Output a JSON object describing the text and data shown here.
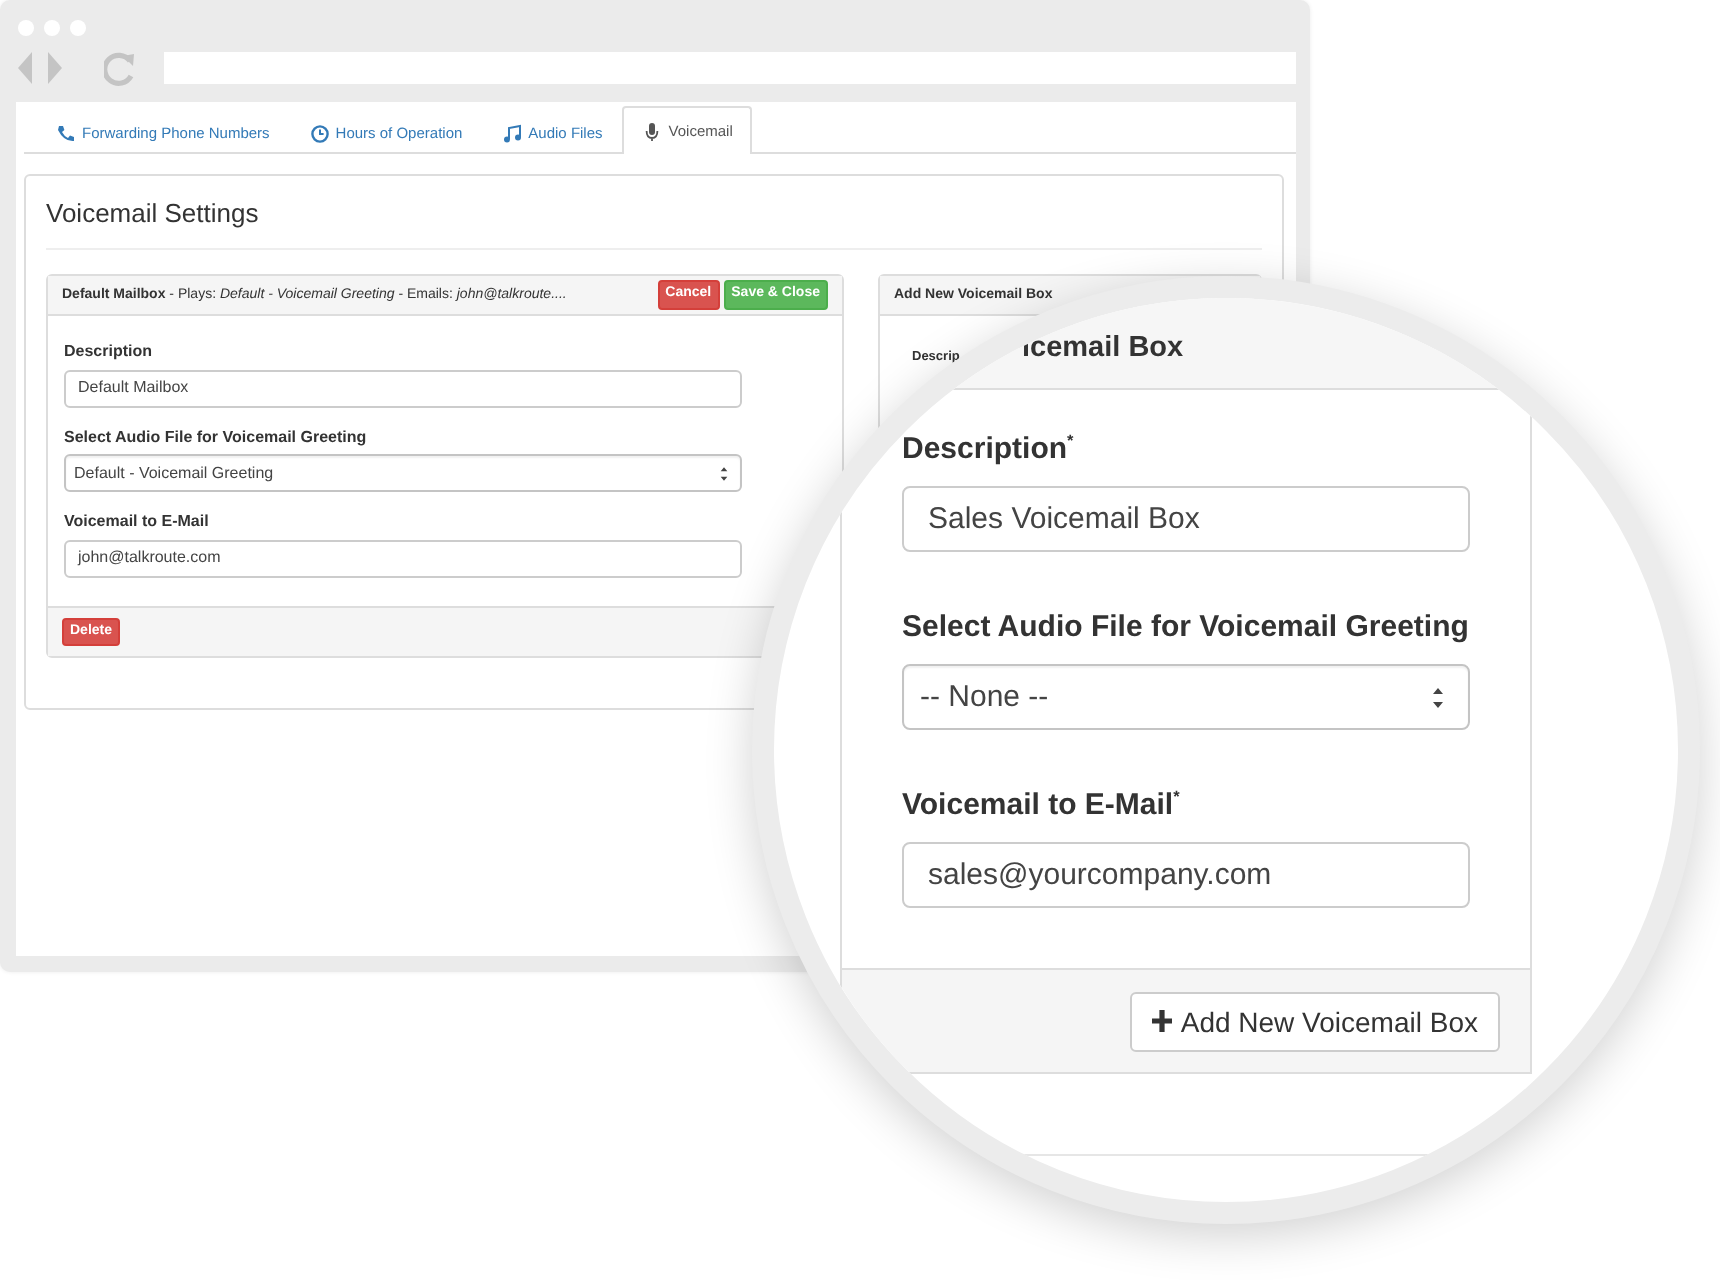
{
  "tabs": [
    {
      "label": "Forwarding Phone Numbers",
      "kind": "phone",
      "selected": false
    },
    {
      "label": "Hours of Operation",
      "kind": "clock",
      "selected": false
    },
    {
      "label": "Audio Files",
      "kind": "music",
      "selected": false
    },
    {
      "label": "Voicemail",
      "kind": "mic",
      "selected": true
    }
  ],
  "page_title": "Voicemail Settings",
  "mailbox_panel": {
    "header": "**Default Mailbox** - Plays: *Default - Voicemail Greeting* - Emails: *john@talkroute....*",
    "buttons": [
      {
        "label": "Cancel",
        "kind": "danger"
      },
      {
        "label": "Save & Close",
        "kind": "success"
      }
    ],
    "fields": [
      {
        "kind": "input",
        "label": "Description",
        "value": "Default Mailbox"
      },
      {
        "kind": "select",
        "label": "Select Audio File for Voicemail Greeting",
        "value": "Default - Voicemail Greeting"
      },
      {
        "kind": "input",
        "label": "Voicemail to E-Mail",
        "value": "john@talkroute.com"
      }
    ],
    "footer_buttons": [
      {
        "label": "Delete",
        "kind": "danger"
      }
    ]
  },
  "add_panel": {
    "title": "Add New Voicemail Box",
    "field_label": "Descrip"
  },
  "magnifier": {
    "header": "icemail Box",
    "fields": [
      {
        "kind": "input",
        "label": "Description$^{*}$",
        "value": "Sales Voicemail Box"
      },
      {
        "kind": "select",
        "label": "Select Audio File for Voicemail Greeting",
        "value": "-- None --"
      },
      {
        "kind": "input",
        "label": "Voicemail to E-Mail$^{*}$",
        "value": "sales@yourcompany.com"
      }
    ],
    "button": {
      "label": "Add New Voicemail Box"
    }
  }
}
